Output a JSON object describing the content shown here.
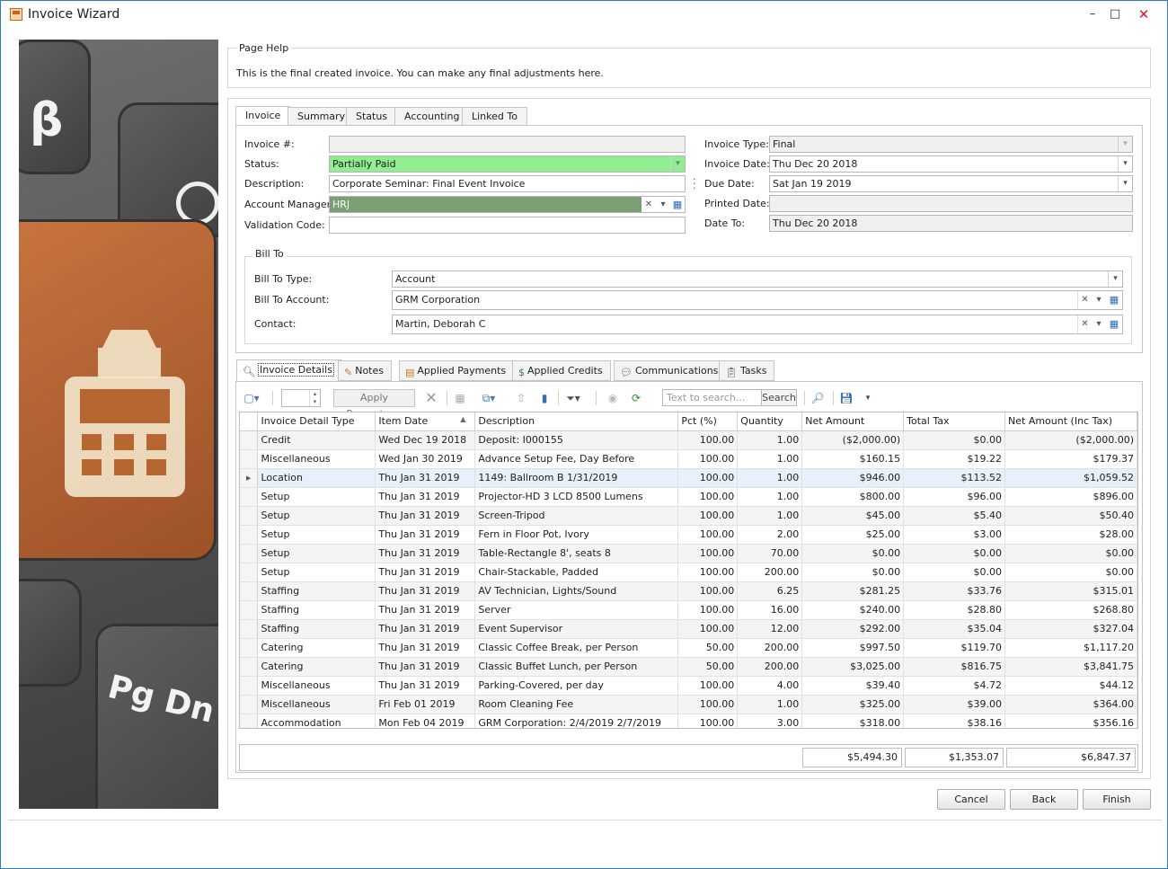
{
  "window": {
    "title": "Invoice Wizard",
    "minimize": "–",
    "maximize": "□",
    "close": "✕"
  },
  "page_help": {
    "title": "Page Help",
    "text": "This is the final created invoice.  You can make any final adjustments here."
  },
  "upper_tabs": [
    "Invoice",
    "Summary",
    "Status",
    "Accounting",
    "Linked To"
  ],
  "invoice": {
    "invoice_no_label": "Invoice #:",
    "invoice_no_value": "",
    "status_label": "Status:",
    "status_value": "Partially Paid",
    "description_label": "Description:",
    "description_value": "Corporate Seminar: Final Event Invoice",
    "account_manager_label": "Account Manager:",
    "account_manager_value": "HRJ",
    "validation_code_label": "Validation Code:",
    "validation_code_value": "",
    "invoice_type_label": "Invoice Type:",
    "invoice_type_value": "Final",
    "invoice_date_label": "Invoice Date:",
    "invoice_date_value": "Thu Dec 20 2018",
    "due_date_label": "Due Date:",
    "due_date_value": "Sat Jan 19 2019",
    "printed_date_label": "Printed Date:",
    "printed_date_value": "",
    "date_to_label": "Date To:",
    "date_to_value": "Thu Dec 20 2018",
    "status_color": "#90ee90",
    "account_manager_color": "#7a9f73"
  },
  "bill_to": {
    "title": "Bill To",
    "type_label": "Bill To Type:",
    "type_value": "Account",
    "account_label": "Bill To Account:",
    "account_value": "GRM Corporation",
    "contact_label": "Contact:",
    "contact_value": "Martin, Deborah C"
  },
  "lower_tabs": [
    "Invoice Details",
    "Notes",
    "Applied Payments",
    "Applied Credits",
    "Communications",
    "Tasks"
  ],
  "toolbar": {
    "apply_percentage": "Apply Percentage",
    "search_placeholder": "Text to search...",
    "search_button": "Search"
  },
  "grid": {
    "columns": [
      "Invoice Detail Type",
      "Item Date",
      "Description",
      "Pct (%)",
      "Quantity",
      "Net Amount",
      "Total Tax",
      "Net Amount (Inc Tax)"
    ],
    "rows": [
      [
        "Credit",
        "Wed Dec 19 2018",
        "Deposit: I000155",
        "100.00",
        "1.00",
        "($2,000.00)",
        "$0.00",
        "($2,000.00)"
      ],
      [
        "Miscellaneous",
        "Wed Jan 30 2019",
        "Advance Setup Fee, Day Before",
        "100.00",
        "1.00",
        "$160.15",
        "$19.22",
        "$179.37"
      ],
      [
        "Location",
        "Thu Jan 31 2019",
        "1149: Ballroom B 1/31/2019",
        "100.00",
        "1.00",
        "$946.00",
        "$113.52",
        "$1,059.52"
      ],
      [
        "Setup",
        "Thu Jan 31 2019",
        "Projector-HD 3 LCD 8500 Lumens",
        "100.00",
        "1.00",
        "$800.00",
        "$96.00",
        "$896.00"
      ],
      [
        "Setup",
        "Thu Jan 31 2019",
        "Screen-Tripod",
        "100.00",
        "1.00",
        "$45.00",
        "$5.40",
        "$50.40"
      ],
      [
        "Setup",
        "Thu Jan 31 2019",
        "Fern in Floor Pot, Ivory",
        "100.00",
        "2.00",
        "$25.00",
        "$3.00",
        "$28.00"
      ],
      [
        "Setup",
        "Thu Jan 31 2019",
        "Table-Rectangle 8', seats 8",
        "100.00",
        "70.00",
        "$0.00",
        "$0.00",
        "$0.00"
      ],
      [
        "Setup",
        "Thu Jan 31 2019",
        "Chair-Stackable, Padded",
        "100.00",
        "200.00",
        "$0.00",
        "$0.00",
        "$0.00"
      ],
      [
        "Staffing",
        "Thu Jan 31 2019",
        "AV Technician, Lights/Sound",
        "100.00",
        "6.25",
        "$281.25",
        "$33.76",
        "$315.01"
      ],
      [
        "Staffing",
        "Thu Jan 31 2019",
        "Server",
        "100.00",
        "16.00",
        "$240.00",
        "$28.80",
        "$268.80"
      ],
      [
        "Staffing",
        "Thu Jan 31 2019",
        "Event Supervisor",
        "100.00",
        "12.00",
        "$292.00",
        "$35.04",
        "$327.04"
      ],
      [
        "Catering",
        "Thu Jan 31 2019",
        "Classic Coffee Break, per Person",
        "50.00",
        "200.00",
        "$997.50",
        "$119.70",
        "$1,117.20"
      ],
      [
        "Catering",
        "Thu Jan 31 2019",
        "Classic Buffet Lunch, per Person",
        "50.00",
        "200.00",
        "$3,025.00",
        "$816.75",
        "$3,841.75"
      ],
      [
        "Miscellaneous",
        "Thu Jan 31 2019",
        "Parking-Covered, per day",
        "100.00",
        "4.00",
        "$39.40",
        "$4.72",
        "$44.12"
      ],
      [
        "Miscellaneous",
        "Fri Feb 01 2019",
        "Room Cleaning Fee",
        "100.00",
        "1.00",
        "$325.00",
        "$39.00",
        "$364.00"
      ],
      [
        "Accommodation",
        "Mon Feb 04 2019",
        "GRM Corporation: 2/4/2019 2/7/2019",
        "100.00",
        "3.00",
        "$318.00",
        "$38.16",
        "$356.16"
      ]
    ],
    "selected_row": 2
  },
  "totals": {
    "net_amount": "$5,494.30",
    "total_tax": "$1,353.07",
    "net_amount_inc_tax": "$6,847.37"
  },
  "buttons": {
    "cancel": "Cancel",
    "back": "Back",
    "finish": "Finish"
  },
  "sidebar_image": {
    "key_letters": [
      "β",
      "Pg Dn E"
    ]
  }
}
